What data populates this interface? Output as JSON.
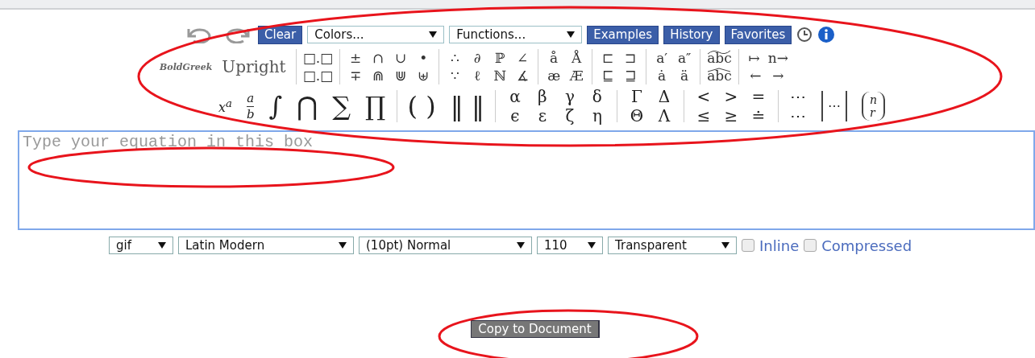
{
  "toolbar": {
    "clear": "Clear",
    "colors": "Colors...",
    "functions": "Functions...",
    "buttons": [
      "Examples",
      "History",
      "Favorites"
    ]
  },
  "palette": {
    "styles": [
      "BoldGreek",
      "Upright"
    ],
    "groups": [
      {
        "top": [
          {
            "text": "□.□"
          }
        ],
        "bottom": [
          {
            "text": "□.□"
          }
        ]
      },
      {
        "top": [
          {
            "text": "±"
          },
          {
            "text": "∩"
          },
          {
            "text": "∪"
          },
          {
            "text": "•"
          }
        ],
        "bottom": [
          {
            "text": "∓"
          },
          {
            "text": "⋒"
          },
          {
            "text": "⋓"
          },
          {
            "text": "⊎"
          }
        ]
      },
      {
        "top": [
          {
            "text": "∴"
          },
          {
            "text": "∂"
          },
          {
            "text": "ℙ"
          },
          {
            "text": "∠"
          }
        ],
        "bottom": [
          {
            "text": "∵"
          },
          {
            "text": "ℓ"
          },
          {
            "text": "ℕ"
          },
          {
            "text": "∡"
          }
        ]
      },
      {
        "top": [
          {
            "text": "å"
          },
          {
            "text": "Å"
          }
        ],
        "bottom": [
          {
            "text": "æ"
          },
          {
            "text": "Æ"
          }
        ]
      },
      {
        "top": [
          {
            "text": "⊏"
          },
          {
            "text": "⊐"
          }
        ],
        "bottom": [
          {
            "text": "⊑"
          },
          {
            "text": "⊒"
          }
        ]
      },
      {
        "top": [
          {
            "text": "a′"
          },
          {
            "text": "a″"
          }
        ],
        "bottom": [
          {
            "text": "ȧ"
          },
          {
            "text": "ä"
          }
        ]
      },
      {
        "top": [
          {
            "text": "abc",
            "kind": "tilde"
          }
        ],
        "bottom": [
          {
            "text": "abc",
            "kind": "hat"
          }
        ]
      },
      {
        "top": [
          {
            "text": "↦"
          },
          {
            "text": "n→"
          }
        ],
        "bottom": [
          {
            "text": "←"
          },
          {
            "text": "→"
          }
        ]
      }
    ],
    "big": [
      {
        "kind": "sup",
        "base": "x",
        "sup": "a"
      },
      {
        "kind": "frac",
        "num": "a",
        "den": "b"
      },
      {
        "kind": "symbol",
        "text": "∫"
      },
      {
        "kind": "symbol",
        "text": "⋂"
      },
      {
        "kind": "symbol",
        "text": "∑"
      },
      {
        "kind": "symbol",
        "text": "∏"
      },
      {
        "kind": "sep"
      },
      {
        "kind": "symbol",
        "text": "( )"
      },
      {
        "kind": "symbol",
        "text": "‖ ‖"
      },
      {
        "kind": "sep"
      },
      {
        "kind": "pair",
        "top": [
          "α",
          "β",
          "γ",
          "δ"
        ],
        "bottom": [
          "ϵ",
          "ε",
          "ζ",
          "η"
        ]
      },
      {
        "kind": "sep"
      },
      {
        "kind": "pair",
        "top": [
          "Γ",
          "Δ"
        ],
        "bottom": [
          "Θ",
          "Λ"
        ]
      },
      {
        "kind": "sep"
      },
      {
        "kind": "pair",
        "top": [
          "<",
          ">",
          "="
        ],
        "bottom": [
          "≤",
          "≥",
          "≐"
        ]
      },
      {
        "kind": "sep"
      },
      {
        "kind": "pair",
        "top": [
          "⋯"
        ],
        "bottom": [
          "⋯"
        ]
      },
      {
        "kind": "matrix",
        "text": "⋯"
      },
      {
        "kind": "binom",
        "top": "n",
        "bottom": "r"
      }
    ]
  },
  "editor": {
    "placeholder": "Type your equation in this box"
  },
  "options": {
    "selects": [
      "gif",
      "Latin Modern",
      "(10pt) Normal",
      "110",
      "Transparent"
    ],
    "checks": [
      {
        "label": "Inline",
        "checked": false
      },
      {
        "label": "Compressed",
        "checked": false
      }
    ]
  },
  "copy_button": "Copy to Document"
}
